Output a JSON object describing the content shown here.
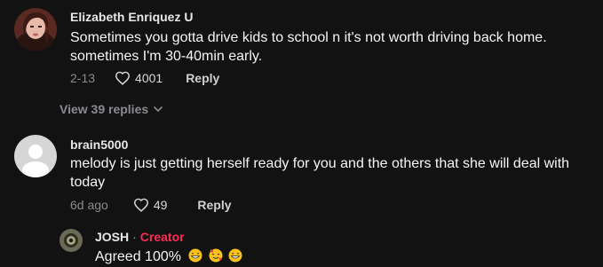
{
  "comments": [
    {
      "username": "Elizabeth Enriquez U",
      "text_line1": "Sometimes you gotta drive kids to school n it's not worth driving back home.",
      "text_line2": "sometimes I'm 30-40min early.",
      "date": "2-13",
      "likes": "4001",
      "reply_label": "Reply",
      "view_replies": "View 39 replies"
    },
    {
      "username": "brain5000",
      "text_line1": "melody is just getting herself ready for you and the others that she will deal with",
      "text_line2": "today",
      "date": "6d ago",
      "likes": "49",
      "reply_label": "Reply"
    }
  ],
  "reply": {
    "username": "JOSH",
    "separator": "·",
    "badge": "Creator",
    "text": "Agreed 100%",
    "emojis": [
      "grinning-face-icon",
      "smiling-face-with-hearts-icon",
      "grinning-face-icon"
    ]
  },
  "colors": {
    "background": "#121212",
    "creator_badge": "#fe2c55",
    "muted": "#8a8b91"
  }
}
